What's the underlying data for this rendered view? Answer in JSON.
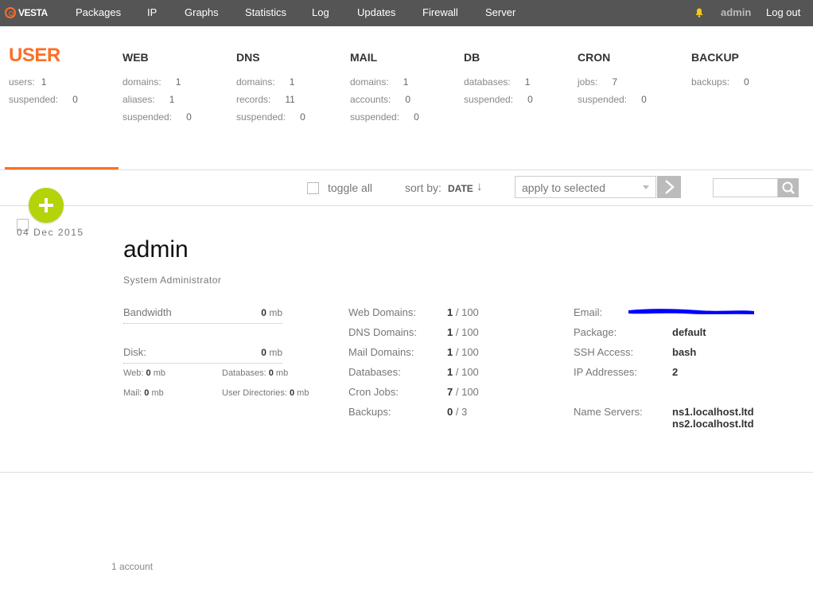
{
  "topbar": {
    "logo": "VESTA",
    "nav": [
      "Packages",
      "IP",
      "Graphs",
      "Statistics",
      "Log",
      "Updates",
      "Firewall",
      "Server"
    ],
    "user": "admin",
    "logout": "Log out"
  },
  "summary": {
    "user": {
      "title": "USER",
      "stats": [
        {
          "label": "users:",
          "value": "1"
        },
        {
          "label": "suspended:",
          "value": "0"
        }
      ]
    },
    "web": {
      "title": "WEB",
      "stats": [
        {
          "label": "domains:",
          "value": "1"
        },
        {
          "label": "aliases:",
          "value": "1"
        },
        {
          "label": "suspended:",
          "value": "0"
        }
      ]
    },
    "dns": {
      "title": "DNS",
      "stats": [
        {
          "label": "domains:",
          "value": "1"
        },
        {
          "label": "records:",
          "value": "11"
        },
        {
          "label": "suspended:",
          "value": "0"
        }
      ]
    },
    "mail": {
      "title": "MAIL",
      "stats": [
        {
          "label": "domains:",
          "value": "1"
        },
        {
          "label": "accounts:",
          "value": "0"
        },
        {
          "label": "suspended:",
          "value": "0"
        }
      ]
    },
    "db": {
      "title": "DB",
      "stats": [
        {
          "label": "databases:",
          "value": "1"
        },
        {
          "label": "suspended:",
          "value": "0"
        }
      ]
    },
    "cron": {
      "title": "CRON",
      "stats": [
        {
          "label": "jobs:",
          "value": "7"
        },
        {
          "label": "suspended:",
          "value": "0"
        }
      ]
    },
    "backup": {
      "title": "BACKUP",
      "stats": [
        {
          "label": "backups:",
          "value": "0"
        }
      ]
    }
  },
  "toolbar": {
    "toggle_all": "toggle all",
    "sort_by": "sort by:",
    "sort_value": "DATE",
    "sort_arrow": "↓",
    "apply_placeholder": "apply to selected"
  },
  "record": {
    "date": "04  Dec  2015",
    "name": "admin",
    "role": "System Administrator",
    "bandwidth": {
      "label": "Bandwidth",
      "value": "0",
      "unit": "mb"
    },
    "disk": {
      "label": "Disk:",
      "value": "0",
      "unit": "mb"
    },
    "disk_detail": {
      "web": {
        "label": "Web:",
        "value": "0",
        "unit": "mb"
      },
      "databases": {
        "label": "Databases:",
        "value": "0",
        "unit": "mb"
      },
      "mail": {
        "label": "Mail:",
        "value": "0",
        "unit": "mb"
      },
      "user_dirs": {
        "label": "User Directories:",
        "value": "0",
        "unit": "mb"
      }
    },
    "limits": [
      {
        "label": "Web Domains:",
        "used": "1",
        "limit": "/ 100"
      },
      {
        "label": "DNS Domains:",
        "used": "1",
        "limit": "/ 100"
      },
      {
        "label": "Mail Domains:",
        "used": "1",
        "limit": "/ 100"
      },
      {
        "label": "Databases:",
        "used": "1",
        "limit": "/ 100"
      },
      {
        "label": "Cron Jobs:",
        "used": "7",
        "limit": "/ 100"
      },
      {
        "label": "Backups:",
        "used": "0",
        "limit": "/ 3"
      }
    ],
    "info": {
      "email_label": "Email:",
      "package_label": "Package:",
      "package": "default",
      "ssh_label": "SSH Access:",
      "ssh": "bash",
      "ip_label": "IP Addresses:",
      "ip": "2",
      "ns_label": "Name Servers:",
      "ns1": "ns1.localhost.ltd",
      "ns2": "ns2.localhost.ltd"
    }
  },
  "footer": {
    "count": "1 account"
  },
  "colors": {
    "accent": "#ff6e25",
    "add_button": "#b5d30a",
    "topbar": "#555555",
    "redaction": "#0000ff"
  }
}
